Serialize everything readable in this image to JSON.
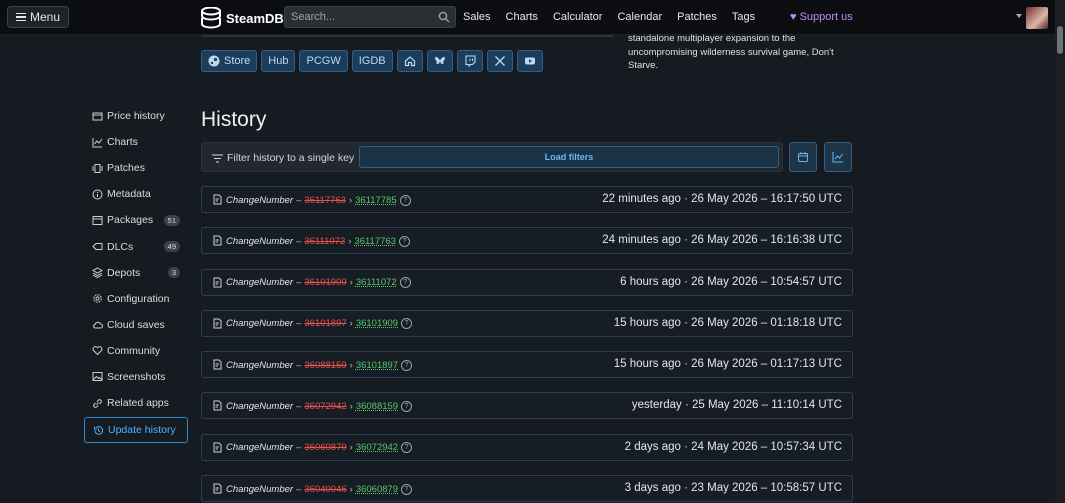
{
  "topbar": {
    "menu_label": "Menu",
    "logo_text": "SteamDB",
    "search_placeholder": "Search...",
    "nav": [
      "Sales",
      "Charts",
      "Calculator",
      "Calendar",
      "Patches",
      "Tags"
    ],
    "support_label": "♥ Support us"
  },
  "app": {
    "description": "standalone multiplayer expansion to the uncompromising wilderness survival game, Don't Starve.",
    "links": [
      "Store",
      "Hub",
      "PCGW",
      "IGDB"
    ],
    "link_icons": [
      "home-icon",
      "bluesky-icon",
      "twitch-icon",
      "x-icon",
      "youtube-icon"
    ]
  },
  "sidebar": {
    "items": [
      {
        "label": "Price history",
        "icon": "price-icon"
      },
      {
        "label": "Charts",
        "icon": "chart-icon"
      },
      {
        "label": "Patches",
        "icon": "patches-icon"
      },
      {
        "label": "Metadata",
        "icon": "info-icon"
      },
      {
        "label": "Packages",
        "icon": "package-icon",
        "badge": "51"
      },
      {
        "label": "DLCs",
        "icon": "dlc-icon",
        "badge": "49"
      },
      {
        "label": "Depots",
        "icon": "depot-icon",
        "badge": "3"
      },
      {
        "label": "Configuration",
        "icon": "gear-icon"
      },
      {
        "label": "Cloud saves",
        "icon": "cloud-icon"
      },
      {
        "label": "Community",
        "icon": "heart-icon"
      },
      {
        "label": "Screenshots",
        "icon": "image-icon"
      },
      {
        "label": "Related apps",
        "icon": "link-icon"
      },
      {
        "label": "Update history",
        "icon": "history-icon",
        "active": true
      }
    ]
  },
  "history": {
    "title": "History",
    "filter_label": "Filter history to a single key",
    "load_filters": "Load filters",
    "rows": [
      {
        "label": "ChangeNumber",
        "old": "36117763",
        "new": "36117785",
        "time": "22 minutes ago · 26 May 2026 – 16:17:50 UTC"
      },
      {
        "label": "ChangeNumber",
        "old": "36111072",
        "new": "36117763",
        "time": "24 minutes ago · 26 May 2026 – 16:16:38 UTC"
      },
      {
        "label": "ChangeNumber",
        "old": "36101909",
        "new": "36111072",
        "time": "6 hours ago · 26 May 2026 – 10:54:57 UTC"
      },
      {
        "label": "ChangeNumber",
        "old": "36101897",
        "new": "36101909",
        "time": "15 hours ago · 26 May 2026 – 01:18:18 UTC"
      },
      {
        "label": "ChangeNumber",
        "old": "36088159",
        "new": "36101897",
        "time": "15 hours ago · 26 May 2026 – 01:17:13 UTC"
      },
      {
        "label": "ChangeNumber",
        "old": "36072942",
        "new": "36088159",
        "time": "yesterday · 25 May 2026 – 11:10:14 UTC"
      },
      {
        "label": "ChangeNumber",
        "old": "36060879",
        "new": "36072942",
        "time": "2 days ago · 24 May 2026 – 10:57:34 UTC"
      },
      {
        "label": "ChangeNumber",
        "old": "36040046",
        "new": "36060879",
        "time": "3 days ago · 23 May 2026 – 10:58:57 UTC"
      }
    ]
  },
  "colors": {
    "accent": "#4fb3ff",
    "old": "#e5534b",
    "new": "#57c76a",
    "support": "#c58af9"
  }
}
